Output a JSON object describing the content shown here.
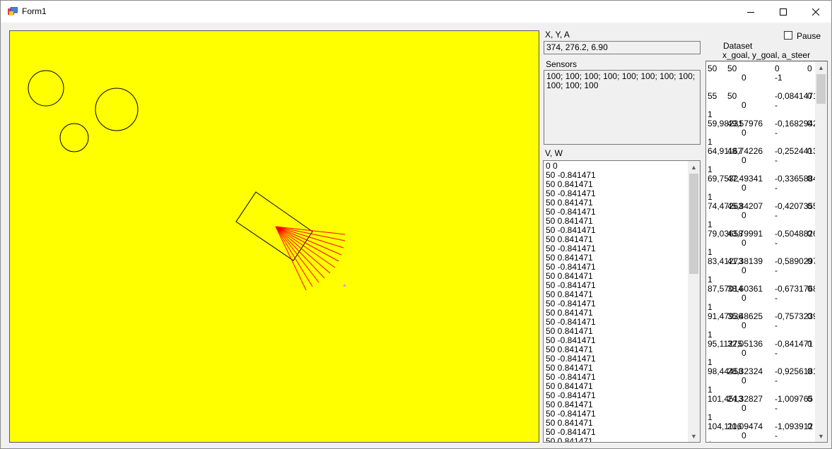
{
  "window": {
    "title": "Form1"
  },
  "pose": {
    "label": "X, Y, A",
    "value": "374, 276.2, 6.90"
  },
  "sensors": {
    "label": "Sensors",
    "value": "100; 100; 100; 100; 100; 100; 100; 100; 100; 100; 100"
  },
  "vw": {
    "label": "V, W",
    "items": [
      "0 0",
      "50 -0.841471",
      "50 0.841471",
      "50 -0.841471",
      "50 0.841471",
      "50 -0.841471",
      "50 0.841471",
      "50 -0.841471",
      "50 0.841471",
      "50 -0.841471",
      "50 0.841471",
      "50 -0.841471",
      "50 0.841471",
      "50 -0.841471",
      "50 0.841471",
      "50 -0.841471",
      "50 0.841471",
      "50 -0.841471",
      "50 0.841471",
      "50 -0.841471",
      "50 0.841471",
      "50 -0.841471",
      "50 0.841471",
      "50 -0.841471",
      "50 0.841471",
      "50 -0.841471",
      "50 0.841471",
      "50 -0.841471",
      "50 0.841471",
      "50 -0.841471",
      "50 0.841471"
    ]
  },
  "pause": {
    "label": "Pause",
    "checked": false
  },
  "dataset": {
    "title": "Dataset",
    "columns": "x_goal, y_goal, a_steer",
    "rows": [
      {
        "a": "50",
        "b": "50",
        "c": "0",
        "d": "0",
        "e": "0",
        "f": "-1",
        "g": ""
      },
      {
        "a": "55",
        "b": "50",
        "c": "-0,0841471",
        "d": "0",
        "e": "0",
        "f": "-",
        "g": "1"
      },
      {
        "a": "59,98231",
        "b": "49,57976",
        "c": "-0,1682942",
        "d": "0",
        "e": "0",
        "f": "-",
        "g": "1"
      },
      {
        "a": "64,91167",
        "b": "48,74226",
        "c": "-0,2524413",
        "d": "0",
        "e": "0",
        "f": "-",
        "g": "1"
      },
      {
        "a": "69,7532",
        "b": "47,49341",
        "c": "-0,3365884",
        "d": "0",
        "e": "0",
        "f": "-",
        "g": "1"
      },
      {
        "a": "74,47263",
        "b": "45,84207",
        "c": "-0,4207355",
        "d": "0",
        "e": "0",
        "f": "-",
        "g": "1"
      },
      {
        "a": "79,03658",
        "b": "43,79991",
        "c": "-0,5048826",
        "d": "0",
        "e": "0",
        "f": "-",
        "g": "1"
      },
      {
        "a": "83,41273",
        "b": "41,38139",
        "c": "-0,5890297",
        "d": "0",
        "e": "0",
        "f": "-",
        "g": "1"
      },
      {
        "a": "87,57014",
        "b": "38,60361",
        "c": "-0,6731768",
        "d": "0",
        "e": "0",
        "f": "-",
        "g": "1"
      },
      {
        "a": "91,47936",
        "b": "35,48625",
        "c": "-0,7573239",
        "d": "0",
        "e": "0",
        "f": "-",
        "g": "1"
      },
      {
        "a": "95,11275",
        "b": "32,05136",
        "c": "-0,841471",
        "d": "0",
        "e": "0",
        "f": "-",
        "g": "1"
      },
      {
        "a": "98,44458",
        "b": "28,32324",
        "c": "-0,9256181",
        "d": "0",
        "e": "0",
        "f": "-",
        "g": "1"
      },
      {
        "a": "101,4513",
        "b": "24,32827",
        "c": "-1,009765",
        "d": "0",
        "e": "0",
        "f": "-",
        "g": "1"
      },
      {
        "a": "104,1116",
        "b": "20,09474",
        "c": "-1,093912",
        "d": "0",
        "e": "0",
        "f": "-",
        "g": "1"
      }
    ]
  },
  "colors": {
    "canvas": "#ffff00",
    "rays": "#ff0000",
    "outline": "#000000"
  },
  "icons": {
    "minimize": "minimize-icon",
    "maximize": "maximize-icon",
    "close": "close-icon",
    "app": "app-icon"
  }
}
